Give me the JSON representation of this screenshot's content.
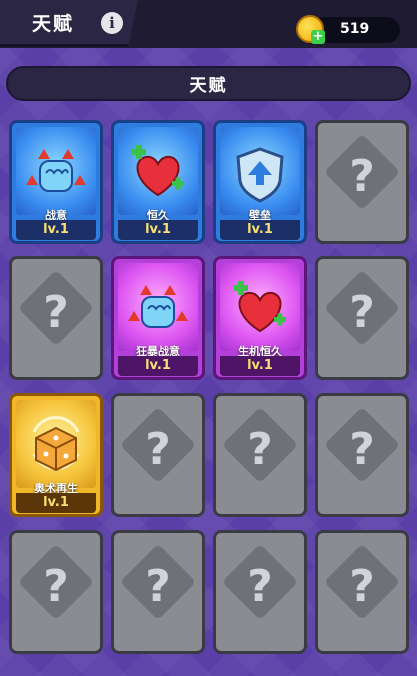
{
  "topbar": {
    "title": "天赋",
    "coins": "519",
    "info_symbol": "i",
    "coin_add_symbol": "+"
  },
  "header": {
    "title": "天赋"
  },
  "locked_symbol": "?",
  "talents": [
    {
      "name": "战意",
      "level": "lv.1",
      "icon": "fist-icon",
      "rarity": "blue"
    },
    {
      "name": "恒久",
      "level": "lv.1",
      "icon": "heart-icon",
      "rarity": "blue"
    },
    {
      "name": "壁垒",
      "level": "lv.1",
      "icon": "shield-icon",
      "rarity": "blue"
    },
    {
      "name": "狂暴战意",
      "level": "lv.1",
      "icon": "fist-icon",
      "rarity": "purple"
    },
    {
      "name": "生机恒久",
      "level": "lv.1",
      "icon": "heart-icon",
      "rarity": "purple"
    },
    {
      "name": "奥术再生",
      "level": "lv.1",
      "icon": "dice-icon",
      "rarity": "gold"
    }
  ]
}
